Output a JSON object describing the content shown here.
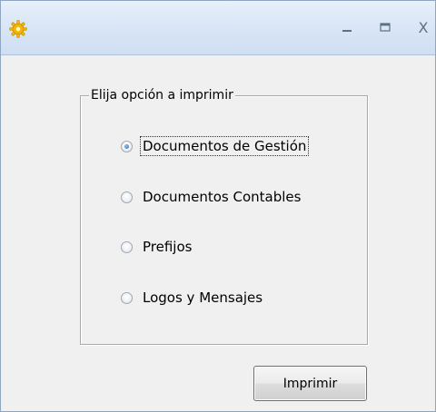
{
  "window": {
    "app_icon": "gear-icon",
    "controls": {
      "minimize_icon": "minimize-icon",
      "maximize_icon": "maximize-icon",
      "close_label": "X"
    }
  },
  "group": {
    "legend": "Elija opción a imprimir",
    "options": [
      {
        "label": "Documentos de Gestión",
        "checked": true
      },
      {
        "label": "Documentos Contables",
        "checked": false
      },
      {
        "label": "Prefijos",
        "checked": false
      },
      {
        "label": "Logos y Mensajes",
        "checked": false
      }
    ]
  },
  "actions": {
    "print_label": "Imprimir"
  },
  "colors": {
    "titlebar": "#d6e4f5",
    "client_bg": "#f0f0f0",
    "app_icon": "#f2b705"
  }
}
